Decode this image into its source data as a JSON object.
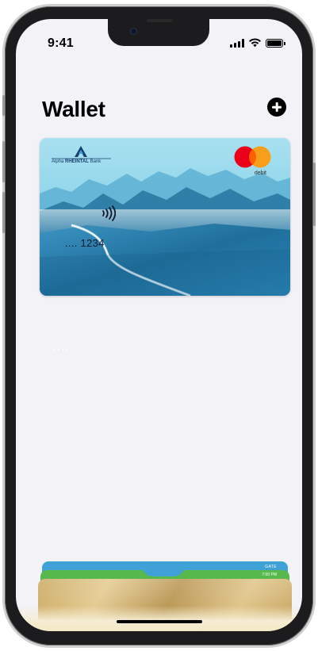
{
  "status_bar": {
    "time": "9:41",
    "battery_level": 1.0
  },
  "wallet": {
    "title": "Wallet",
    "add_button_icon": "plus-circle-icon"
  },
  "card": {
    "bank_name_prefix": "Alpha ",
    "bank_name_bold": "RHEINTAL",
    "bank_name_suffix": " Bank",
    "network": "mastercard",
    "card_type": "debit",
    "number_display": ".... 1234",
    "contactless_icon": "contactless-icon",
    "colors": {
      "sky": "#8fd3ea",
      "mountains": "#2f7fa8",
      "valley": "#1d6b94",
      "river": "#e8f6fb"
    }
  },
  "passes": {
    "blue_label": "GATE",
    "green_label": "7:00 PM",
    "colors": {
      "blue": "#3fa1d6",
      "green": "#57b94c",
      "gold": "#d2b06c"
    }
  }
}
